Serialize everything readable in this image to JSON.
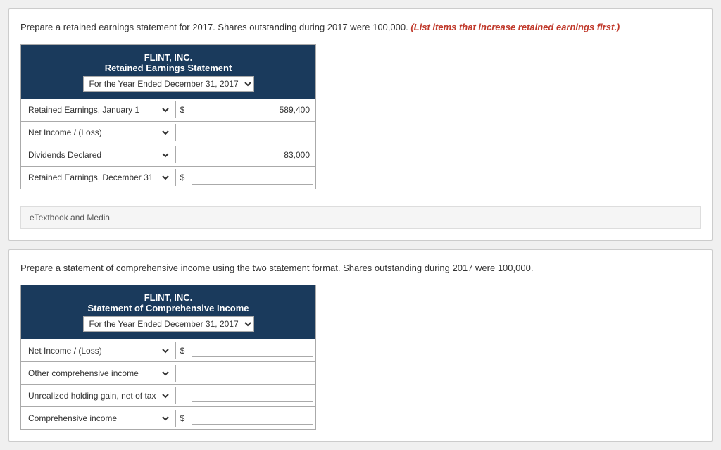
{
  "section1": {
    "instruction": "Prepare a retained earnings statement for 2017. Shares outstanding during 2017 were 100,000.",
    "instruction_highlight": "(List items that increase retained earnings first.)",
    "company": "FLINT, INC.",
    "statement_title": "Retained Earnings Statement",
    "period_label": "For the Year Ended December 31, 2017",
    "rows": [
      {
        "label": "Retained Earnings, January 1",
        "dollar": "$",
        "value": "589,400",
        "has_input": false,
        "has_value": true
      },
      {
        "label": "Net Income / (Loss)",
        "dollar": "",
        "value": "",
        "has_input": true,
        "has_value": false
      },
      {
        "label": "Dividends Declared",
        "dollar": "",
        "value": "83,000",
        "has_input": false,
        "has_value": true
      },
      {
        "label": "Retained Earnings, December 31",
        "dollar": "$",
        "value": "",
        "has_input": true,
        "has_value": false
      }
    ],
    "etextbook_label": "eTextbook and Media"
  },
  "section2": {
    "instruction": "Prepare a statement of comprehensive income using the two statement format. Shares outstanding during 2017 were 100,000.",
    "company": "FLINT, INC.",
    "statement_title": "Statement of Comprehensive Income",
    "period_label": "For the Year Ended December 31, 2017",
    "rows": [
      {
        "label": "Net Income / (Loss)",
        "dollar": "$",
        "has_input": true
      },
      {
        "label": "Other comprehensive income",
        "dollar": "",
        "has_input": false
      },
      {
        "label": "Unrealized holding gain, net of tax",
        "dollar": "",
        "has_input": true
      },
      {
        "label": "Comprehensive income",
        "dollar": "$",
        "has_input": true
      }
    ]
  }
}
